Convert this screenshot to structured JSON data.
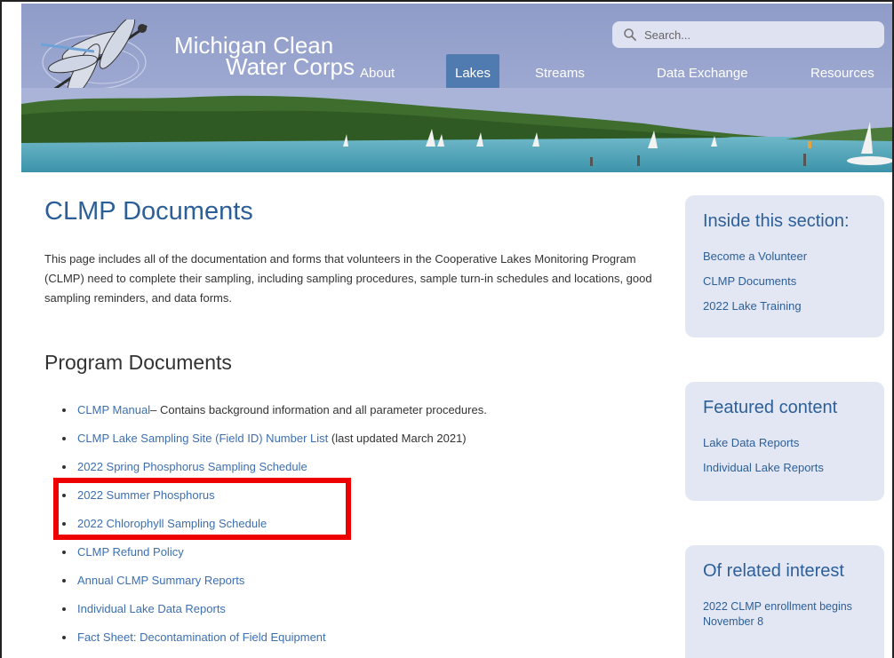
{
  "logo": {
    "line1": "Michigan Clean",
    "line2": "Water Corps"
  },
  "search": {
    "placeholder": "Search..."
  },
  "nav": [
    {
      "label": "About"
    },
    {
      "label": "Lakes",
      "active": true
    },
    {
      "label": "Streams"
    },
    {
      "label": "Data Exchange"
    },
    {
      "label": "Resources"
    }
  ],
  "main": {
    "title": "CLMP Documents",
    "intro": "This page includes all of the documentation and forms that volunteers in the Cooperative Lakes Monitoring Program (CLMP) need to complete their sampling, including sampling procedures, sample turn-in schedules and locations, good sampling reminders, and data forms.",
    "section_title": "Program Documents",
    "documents": [
      {
        "link": "CLMP Manual",
        "note": "– Contains background information and all parameter procedures."
      },
      {
        "link": "CLMP Lake Sampling Site (Field ID) Number List",
        "note": " (last updated March 2021)"
      },
      {
        "link": "2022 Spring Phosphorus Sampling Schedule",
        "note": ""
      },
      {
        "link": "2022 Summer Phosphorus",
        "note": ""
      },
      {
        "link": "2022 Chlorophyll Sampling Schedule",
        "note": ""
      },
      {
        "link": "CLMP Refund Policy",
        "note": ""
      },
      {
        "link": "Annual CLMP Summary Reports",
        "note": ""
      },
      {
        "link": "Individual Lake Data Reports",
        "note": ""
      },
      {
        "link": "Fact Sheet: Decontamination of Field Equipment",
        "note": ""
      }
    ]
  },
  "sidebar": {
    "inside": {
      "title": "Inside this section:",
      "links": [
        "Become a Volunteer",
        "CLMP Documents",
        "2022 Lake Training"
      ]
    },
    "featured": {
      "title": "Featured content",
      "links": [
        "Lake Data Reports",
        "Individual Lake Reports"
      ]
    },
    "related": {
      "title": "Of related interest",
      "item": "2022 CLMP enrollment begins November 8"
    }
  },
  "colors": {
    "header": "#9aa6cf",
    "accent": "#2c5f98",
    "link": "#3d6fb0",
    "active_nav": "#4f7bb0",
    "highlight": "#ee0000",
    "sidebar_card": "#e3e7f3"
  }
}
